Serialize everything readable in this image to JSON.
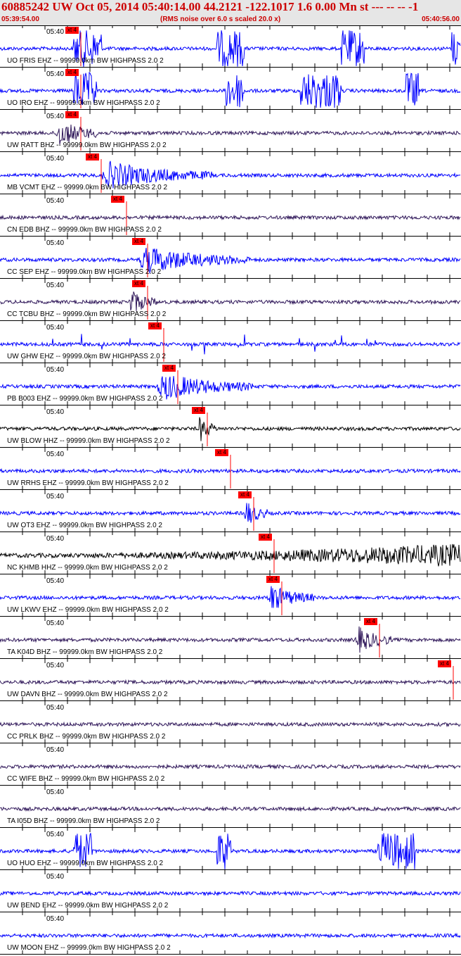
{
  "header": {
    "title": "60885242 UW Oct 05, 2014 05:40:14.00   44.2121 -122.1017  1.6 0.00 Mn st --- -- --   -1",
    "start_time": "05:39:54.00",
    "note": "(RMS noise over 6.0 s scaled 20.0 x)",
    "end_time": "05:40:56.00"
  },
  "colors": {
    "header_text": "#cc0000",
    "header_bg": "#e6e6e6",
    "pick": "#ff0000"
  },
  "time_label": "05:40",
  "traces": [
    {
      "label": "UO FRIS EHZ -- 99999.0km BW  HIGHPASS  2.0  2",
      "pick": "xt 4",
      "color": "#0000ff",
      "pick_frac": 0.175,
      "style": "bursts",
      "bursts": [
        [
          0.16,
          0.22
        ],
        [
          0.47,
          0.53
        ],
        [
          0.74,
          0.79
        ],
        [
          0.98,
          1.0
        ]
      ]
    },
    {
      "label": "UO IRO EHZ -- 99999.0km BW  HIGHPASS  2.0  2",
      "pick": "xt 4",
      "color": "#0000ff",
      "pick_frac": 0.175,
      "style": "bursts",
      "bursts": [
        [
          0.16,
          0.21
        ],
        [
          0.49,
          0.53
        ],
        [
          0.65,
          0.74
        ],
        [
          0.88,
          0.91
        ]
      ]
    },
    {
      "label": "UW RATT BHZ -- 99999.0km BW  HIGHPASS  2.0  2",
      "pick": "xt 4",
      "color": "#30185a",
      "pick_frac": 0.175,
      "style": "event",
      "event": [
        0.12,
        0.22
      ]
    },
    {
      "label": "MB VCMT EHZ -- 99999.0km BW  HIGHPASS  2.0  2",
      "pick": "xt 4",
      "color": "#0000ff",
      "pick_frac": 0.22,
      "style": "event",
      "event": [
        0.22,
        0.46
      ]
    },
    {
      "label": "CN EDB BHZ -- 99999.0km BW  HIGHPASS  2.0  2",
      "pick": "xt 4",
      "color": "#30185a",
      "pick_frac": 0.275,
      "style": "noise"
    },
    {
      "label": "CC SEP EHZ -- 99999.0km BW  HIGHPASS  2.0  2",
      "pick": "xt 4",
      "color": "#0000ff",
      "pick_frac": 0.32,
      "style": "event",
      "event": [
        0.3,
        0.54
      ]
    },
    {
      "label": "CC TCBU BHZ -- 99999.0km BW  HIGHPASS  2.0  2",
      "pick": "xt 4",
      "color": "#30185a",
      "pick_frac": 0.32,
      "style": "event",
      "event": [
        0.28,
        0.34
      ]
    },
    {
      "label": "UW GHW EHZ -- 99999.0km BW  HIGHPASS  2.0  2",
      "pick": "xt 4",
      "color": "#0000ff",
      "pick_frac": 0.355,
      "style": "spiky"
    },
    {
      "label": "PB B003 EHZ -- 99999.0km BW  HIGHPASS  2.0  2",
      "pick": "xt 4",
      "color": "#0000ff",
      "pick_frac": 0.385,
      "style": "event",
      "event": [
        0.34,
        0.55
      ]
    },
    {
      "label": "UW BLOW HHZ -- 99999.0km BW  HIGHPASS  2.0  2",
      "pick": "xt 4",
      "color": "#000000",
      "pick_frac": 0.45,
      "style": "event",
      "event": [
        0.43,
        0.47
      ]
    },
    {
      "label": "UW RRHS EHZ -- 99999.0km BW  HIGHPASS  2.0  2",
      "pick": "xt 4",
      "color": "#0000ff",
      "pick_frac": 0.5,
      "style": "noise"
    },
    {
      "label": "UW OT3 EHZ -- 99999.0km BW  HIGHPASS  2.0  2",
      "pick": "xt 4",
      "color": "#0000ff",
      "pick_frac": 0.55,
      "style": "event",
      "event": [
        0.53,
        0.58
      ]
    },
    {
      "label": "NC KHMB HHZ -- 99999.0km BW  HIGHPASS  2.0  2",
      "pick": "xt 4",
      "color": "#000000",
      "pick_frac": 0.595,
      "style": "growing"
    },
    {
      "label": "UW LKWV EHZ -- 99999.0km BW  HIGHPASS  2.0  2",
      "pick": "xt 4",
      "color": "#0000ff",
      "pick_frac": 0.612,
      "style": "event",
      "event": [
        0.58,
        0.68
      ]
    },
    {
      "label": "TA K04D BHZ -- 99999.0km BW  HIGHPASS  2.0  2",
      "pick": "xt 4",
      "color": "#30185a",
      "pick_frac": 0.823,
      "style": "event",
      "event": [
        0.77,
        0.85
      ]
    },
    {
      "label": "UW DAVN BHZ -- 99999.0km BW  HIGHPASS  2.0  2",
      "pick": "xt 4",
      "color": "#30185a",
      "pick_frac": 0.983,
      "style": "noise"
    },
    {
      "label": "CC PRLK BHZ -- 99999.0km BW  HIGHPASS  2.0  2",
      "pick": "",
      "color": "#30185a",
      "pick_frac": -1,
      "style": "noise"
    },
    {
      "label": "CC WIFE BHZ -- 99999.0km BW  HIGHPASS  2.0  2",
      "pick": "",
      "color": "#30185a",
      "pick_frac": -1,
      "style": "noise"
    },
    {
      "label": "TA I05D BHZ -- 99999.0km BW  HIGHPASS  2.0  2",
      "pick": "",
      "color": "#30185a",
      "pick_frac": -1,
      "style": "noise"
    },
    {
      "label": "UO HUO EHZ -- 99999.0km BW  HIGHPASS  2.0  2",
      "pick": "",
      "color": "#0000ff",
      "pick_frac": -1,
      "style": "bursts",
      "bursts": [
        [
          0.16,
          0.2
        ],
        [
          0.47,
          0.5
        ],
        [
          0.82,
          0.9
        ]
      ]
    },
    {
      "label": "UW BEND EHZ -- 99999.0km BW  HIGHPASS  2.0  2",
      "pick": "",
      "color": "#0000ff",
      "pick_frac": -1,
      "style": "noise"
    },
    {
      "label": "UW MOON EHZ -- 99999.0km BW  HIGHPASS  2.0  2",
      "pick": "",
      "color": "#0000ff",
      "pick_frac": -1,
      "style": "noise"
    }
  ]
}
